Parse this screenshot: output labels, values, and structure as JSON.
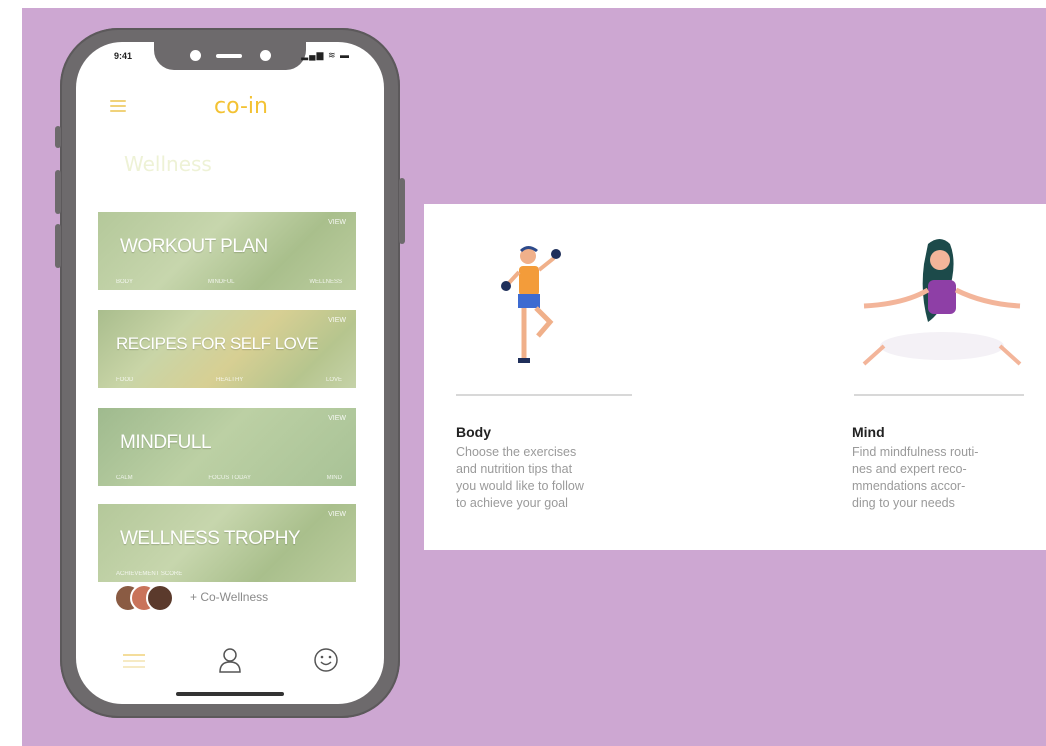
{
  "phone": {
    "status_bar": {
      "time": "9:41",
      "icons": "▂▄▆ ≋ ▬"
    },
    "app_logo": "co-in",
    "section_title": "Wellness",
    "cards": [
      {
        "title": "WORKOUT PLAN",
        "badge": "VIEW",
        "footer": [
          "BODY",
          "MINDFUL",
          "WELLNESS"
        ]
      },
      {
        "title": "RECIPES FOR SELF LOVE",
        "badge": "VIEW",
        "footer": [
          "FOOD",
          "HEALTHY",
          "LOVE"
        ]
      },
      {
        "title": "MINDFULL",
        "badge": "VIEW",
        "footer": [
          "CALM",
          "FOCUS TODAY",
          "MIND"
        ]
      },
      {
        "title": "WELLNESS TROPHY",
        "badge": "VIEW",
        "footer": [
          "ACHIEVEMENT SCORE",
          "",
          ""
        ]
      }
    ],
    "co_wellness_label": "+ Co-Wellness",
    "tabs": [
      "home-icon",
      "profile-icon",
      "smiley-icon"
    ]
  },
  "panel": {
    "body": {
      "title": "Body",
      "lines": [
        "Choose the exercises",
        "and nutrition tips that",
        "you would like to follow",
        "to achieve your goal"
      ]
    },
    "mind": {
      "title": "Mind",
      "lines": [
        "Find mindfulness routi-",
        "nes and expert reco-",
        "mmendations accor-",
        "ding to your needs"
      ]
    }
  },
  "colors": {
    "background": "#cda7d2",
    "accent": "#f3c233",
    "card_green": "#b4c89a",
    "phone_frame": "#6d6a6c"
  }
}
